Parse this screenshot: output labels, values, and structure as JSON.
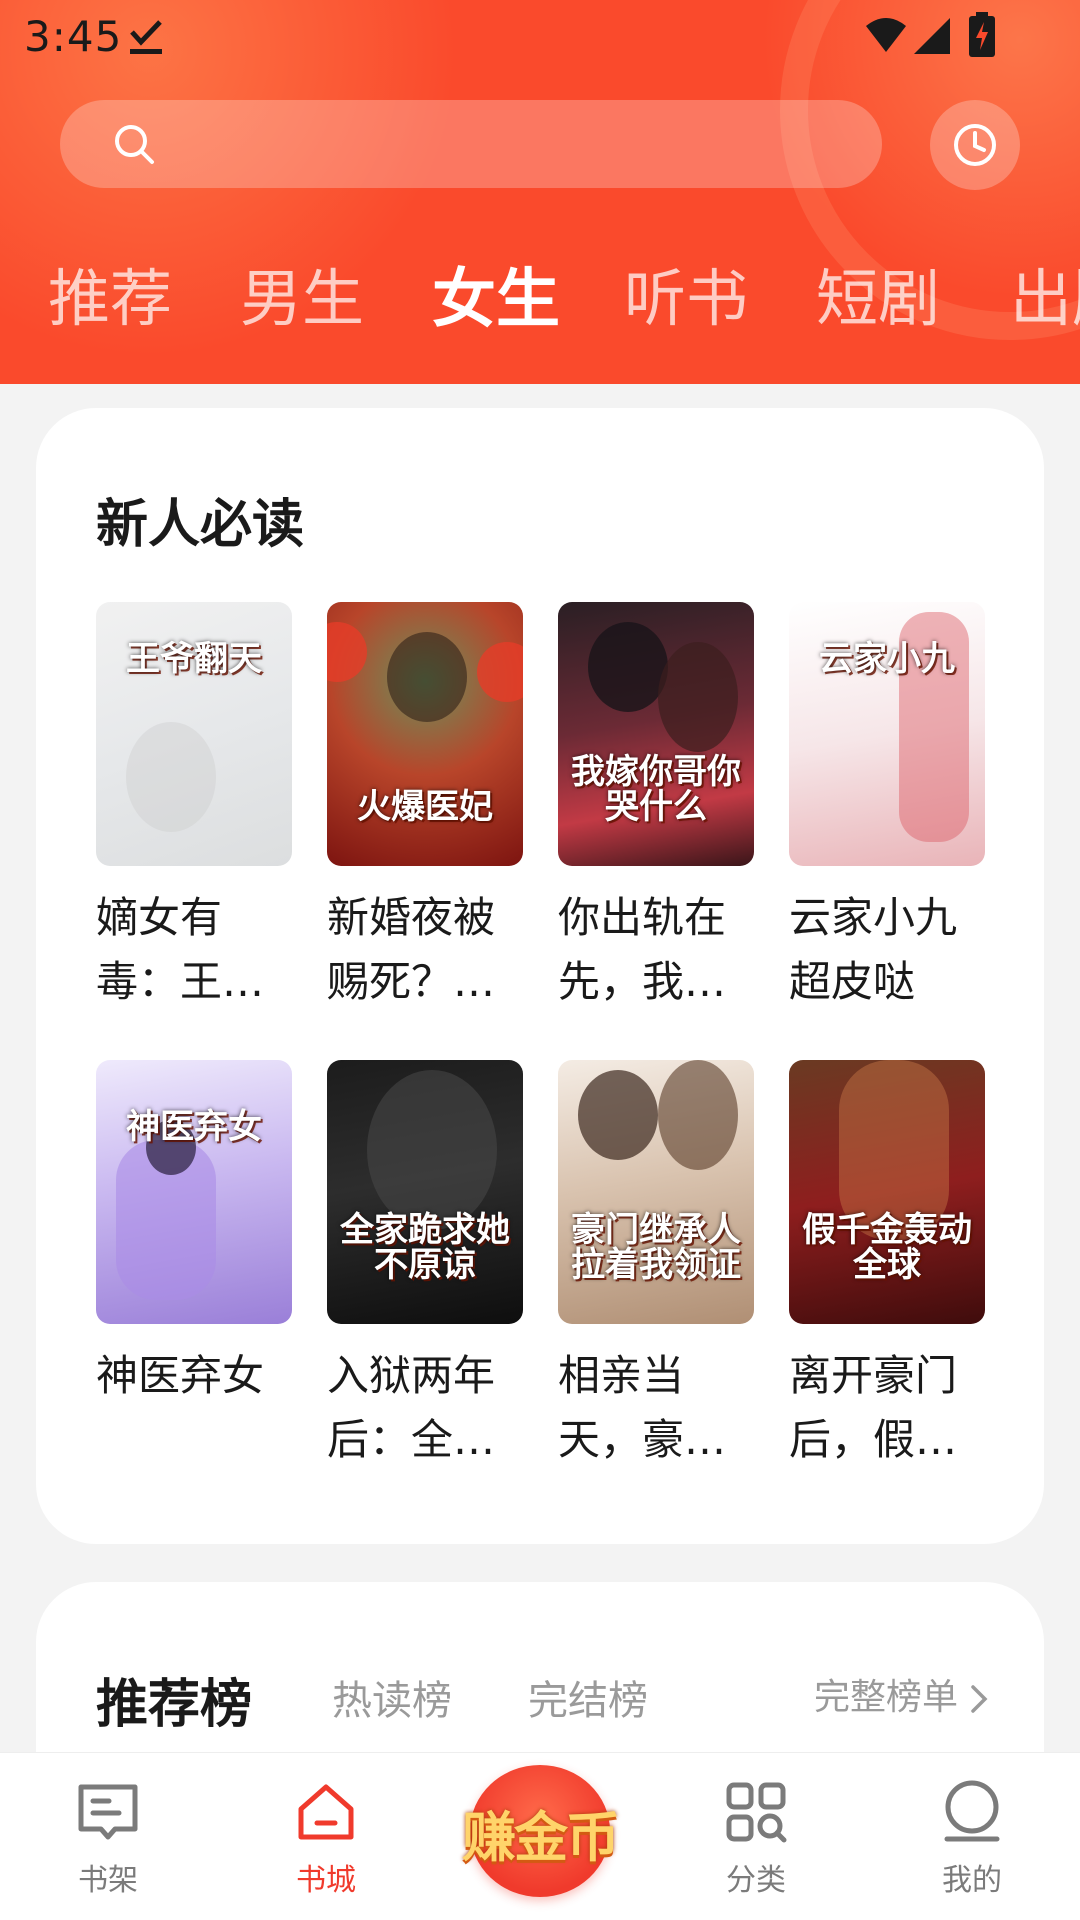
{
  "status_bar": {
    "time": "3:45"
  },
  "search": {
    "placeholder": ""
  },
  "tabs": [
    {
      "label": "推荐"
    },
    {
      "label": "男生"
    },
    {
      "label": "女生"
    },
    {
      "label": "听书"
    },
    {
      "label": "短剧"
    },
    {
      "label": "出版"
    }
  ],
  "new_reads": {
    "title": "新人必读",
    "books": [
      {
        "name": "嫡女有毒：王…",
        "cover_text": "王爷翻天"
      },
      {
        "name": "新婚夜被赐死？…",
        "cover_text": "火爆医妃"
      },
      {
        "name": "你出轨在先，我…",
        "cover_text": "我嫁你哥你哭什么"
      },
      {
        "name": "云家小九超皮哒",
        "cover_text": "云家小九"
      },
      {
        "name": "神医弃女",
        "cover_text": "神医弃女"
      },
      {
        "name": "入狱两年后：全…",
        "cover_text": "全家跪求她不原谅"
      },
      {
        "name": "相亲当天，豪…",
        "cover_text": "豪门继承人拉着我领证"
      },
      {
        "name": "离开豪门后，假…",
        "cover_text": "假千金轰动全球"
      }
    ]
  },
  "ranking": {
    "tabs": [
      {
        "label": "推荐榜"
      },
      {
        "label": "热读榜"
      },
      {
        "label": "完结榜"
      }
    ],
    "full_list_label": "完整榜单"
  },
  "bottom_nav": {
    "items": [
      {
        "label": "书架"
      },
      {
        "label": "书城"
      },
      {
        "label": "赚金币"
      },
      {
        "label": "分类"
      },
      {
        "label": "我的"
      }
    ]
  },
  "colors": {
    "accent": "#fa4a2c",
    "nav_active": "#f03a2c"
  }
}
